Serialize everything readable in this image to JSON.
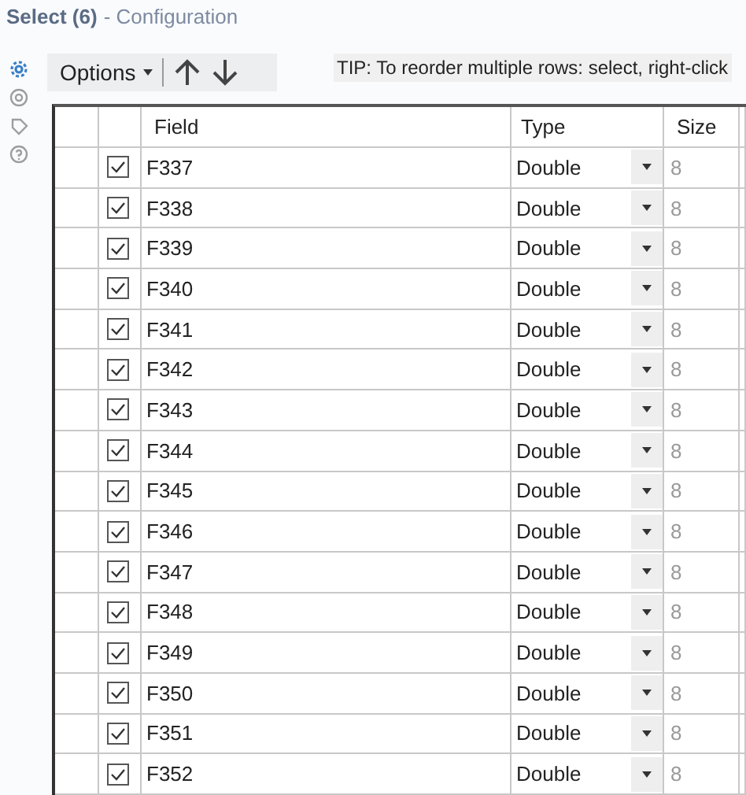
{
  "window": {
    "title": "Select (6)",
    "subtitle": "- Configuration"
  },
  "side_icons": [
    {
      "kind": "gear",
      "selected": true
    },
    {
      "kind": "target",
      "selected": false
    },
    {
      "kind": "tag",
      "selected": false
    },
    {
      "kind": "help",
      "selected": false
    }
  ],
  "toolbar": {
    "options": "Options",
    "tip": "TIP: To reorder multiple rows: select, right-click"
  },
  "table": {
    "columns": [
      "Field",
      "Type",
      "Size"
    ],
    "rows": [
      {
        "checked": true,
        "field": "F337",
        "type": "Double",
        "size": "8"
      },
      {
        "checked": true,
        "field": "F338",
        "type": "Double",
        "size": "8"
      },
      {
        "checked": true,
        "field": "F339",
        "type": "Double",
        "size": "8"
      },
      {
        "checked": true,
        "field": "F340",
        "type": "Double",
        "size": "8"
      },
      {
        "checked": true,
        "field": "F341",
        "type": "Double",
        "size": "8"
      },
      {
        "checked": true,
        "field": "F342",
        "type": "Double",
        "size": "8"
      },
      {
        "checked": true,
        "field": "F343",
        "type": "Double",
        "size": "8"
      },
      {
        "checked": true,
        "field": "F344",
        "type": "Double",
        "size": "8"
      },
      {
        "checked": true,
        "field": "F345",
        "type": "Double",
        "size": "8"
      },
      {
        "checked": true,
        "field": "F346",
        "type": "Double",
        "size": "8"
      },
      {
        "checked": true,
        "field": "F347",
        "type": "Double",
        "size": "8"
      },
      {
        "checked": true,
        "field": "F348",
        "type": "Double",
        "size": "8"
      },
      {
        "checked": true,
        "field": "F349",
        "type": "Double",
        "size": "8"
      },
      {
        "checked": true,
        "field": "F350",
        "type": "Double",
        "size": "8"
      },
      {
        "checked": true,
        "field": "F351",
        "type": "Double",
        "size": "8"
      },
      {
        "checked": true,
        "field": "F352",
        "type": "Double",
        "size": "8"
      }
    ]
  }
}
